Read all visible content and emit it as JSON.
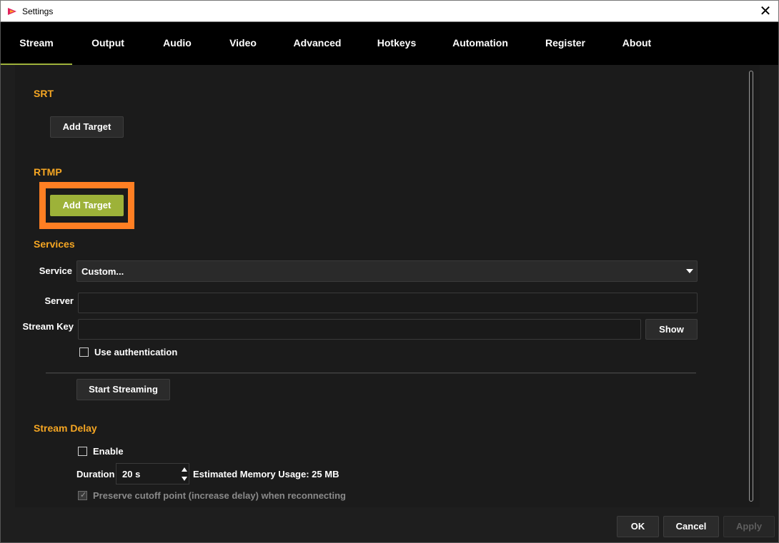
{
  "window": {
    "title": "Settings"
  },
  "tabs": [
    {
      "label": "Stream"
    },
    {
      "label": "Output"
    },
    {
      "label": "Audio"
    },
    {
      "label": "Video"
    },
    {
      "label": "Advanced"
    },
    {
      "label": "Hotkeys"
    },
    {
      "label": "Automation"
    },
    {
      "label": "Register"
    },
    {
      "label": "About"
    }
  ],
  "srt": {
    "title": "SRT",
    "add_target": "Add Target"
  },
  "rtmp": {
    "title": "RTMP",
    "add_target": "Add Target"
  },
  "services": {
    "title": "Services",
    "service_label": "Service",
    "service_value": "Custom...",
    "server_label": "Server",
    "server_value": "",
    "stream_key_label": "Stream Key",
    "stream_key_value": "",
    "show_button": "Show",
    "use_auth_label": "Use authentication",
    "start_streaming": "Start Streaming"
  },
  "delay": {
    "title": "Stream Delay",
    "enable_label": "Enable",
    "duration_label": "Duration",
    "duration_value": "20 s",
    "memory_usage": "Estimated Memory Usage: 25 MB",
    "preserve_label": "Preserve cutoff point (increase delay) when reconnecting"
  },
  "footer": {
    "ok": "OK",
    "cancel": "Cancel",
    "apply": "Apply"
  },
  "colors": {
    "accent_orange": "#f5a623",
    "highlight": "#ff7f23",
    "green": "#9db239"
  }
}
